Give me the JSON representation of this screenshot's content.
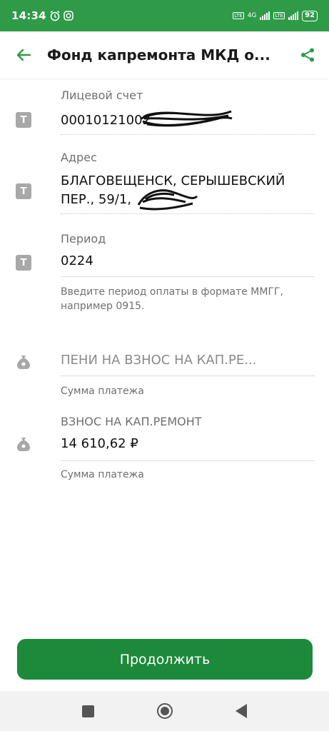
{
  "status_bar": {
    "time": "14:34",
    "network_label": "4G",
    "lte_label": "LTE",
    "battery": "92"
  },
  "header": {
    "title": "Фонд капремонта МКД о..."
  },
  "fields": {
    "account": {
      "label": "Лицевой счет",
      "value": "00010121002"
    },
    "address": {
      "label": "Адрес",
      "value": "БЛАГОВЕЩЕНСК, СЕРЫШЕВСКИЙ ПЕР., 59/1,"
    },
    "period": {
      "label": "Период",
      "value": "0224",
      "helper": "Введите период оплаты в формате ММГГ, например 0915."
    },
    "penalty": {
      "placeholder": "ПЕНИ НА ВЗНОС НА КАП.РЕ...",
      "helper": "Сумма платежа"
    },
    "contribution": {
      "label": "ВЗНОС НА КАП.РЕМОНТ",
      "value": "14 610,62 ₽",
      "helper": "Сумма платежа"
    }
  },
  "actions": {
    "continue_label": "Продолжить"
  },
  "icons": {
    "text_field": "T",
    "money_bag": "money-bag-icon"
  },
  "colors": {
    "brand_green": "#2f9a47",
    "button_green": "#1c8a3a"
  }
}
